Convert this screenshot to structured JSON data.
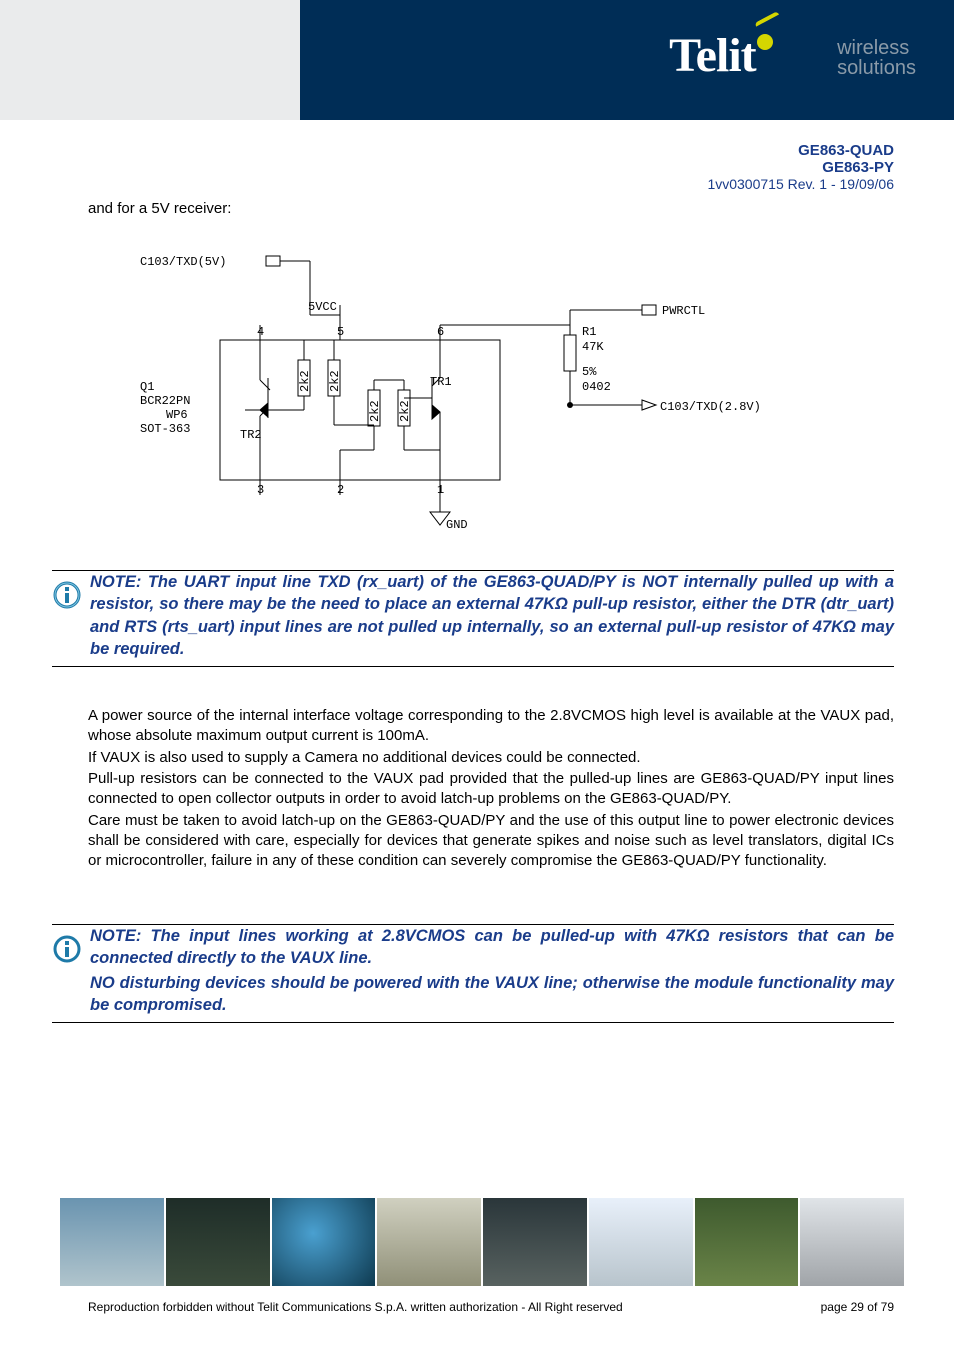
{
  "header": {
    "logo_text": "Telit",
    "tagline1": "wireless",
    "tagline2": "solutions"
  },
  "docid": {
    "line1": "GE863-QUAD",
    "line2": "GE863-PY",
    "rev": "1vv0300715 Rev. 1 - 19/09/06"
  },
  "intro": "and for a 5V receiver:",
  "schem": {
    "txd5v": "C103/TXD(5V)",
    "vcc": "5VCC",
    "q1_a": "Q1",
    "q1_b": "BCR22PN",
    "q1_c": "WP6",
    "q1_d": "SOT-363",
    "tr1": "TR1",
    "tr2": "TR2",
    "r_2k2": "2k2",
    "gnd": "GND",
    "p1": "1",
    "p2": "2",
    "p3": "3",
    "p4": "4",
    "p5": "5",
    "p6": "6",
    "pwrctl": "PWRCTL",
    "r1": "R1",
    "r1v1": "47K",
    "r1v2": "5%",
    "r1v3": "0402",
    "txd28": "C103/TXD(2.8V)"
  },
  "note1": "NOTE: The UART input line TXD (rx_uart) of the GE863-QUAD/PY is NOT internally pulled up with a  resistor, so there may be the need to place an external 47KΩ pull-up resistor, either the DTR (dtr_uart) and RTS (rts_uart) input lines are not pulled up internally, so an external pull-up resistor of 47KΩ may be required.",
  "body": {
    "p1": "A power source of the internal interface voltage corresponding to the 2.8VCMOS high level is available at the VAUX pad, whose absolute maximum output current is 100mA.",
    "p2": "If VAUX is also used to supply a Camera no additional devices could be connected.",
    "p3": "Pull-up resistors can be connected to the VAUX pad provided that the pulled-up lines are GE863-QUAD/PY input lines connected to open collector outputs in order to avoid latch-up problems on the GE863-QUAD/PY.",
    "p4": "Care must be taken to avoid latch-up on the GE863-QUAD/PY and the use of this output line to power electronic devices shall be considered with care, especially for devices that generate spikes and noise such as level translators, digital ICs or microcontroller, failure in any of these condition can severely compromise the GE863-QUAD/PY functionality."
  },
  "note2a": "NOTE: The input lines working at 2.8VCMOS can be pulled-up with 47KΩ resistors that can be connected directly to the VAUX line.",
  "note2b": "NO disturbing devices should be powered with the VAUX line; otherwise the module functionality may be compromised.",
  "footer": {
    "copy": "Reproduction forbidden without Telit Communications S.p.A. written authorization - All Right reserved",
    "page": "page 29 of 79"
  }
}
